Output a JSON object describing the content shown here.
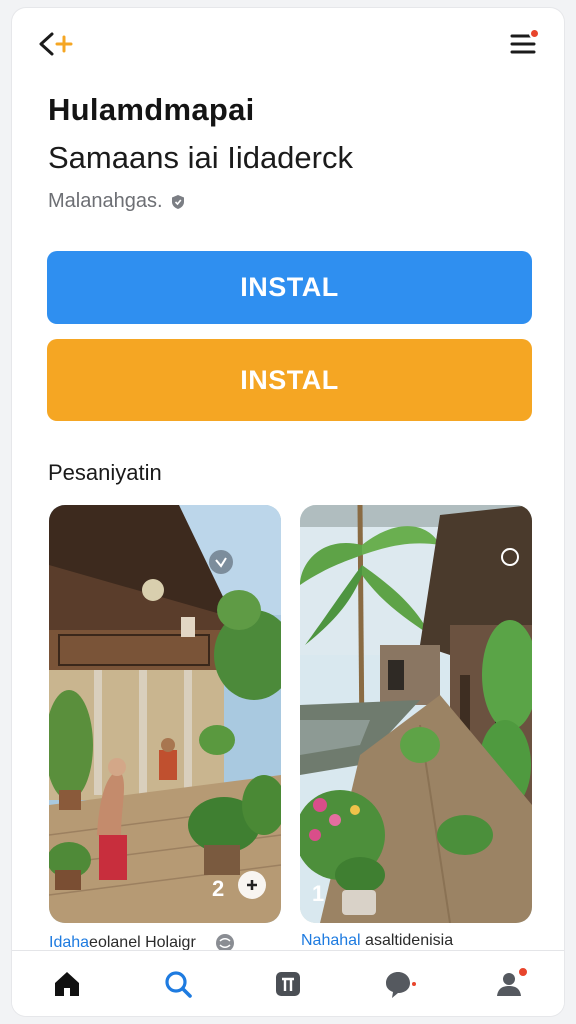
{
  "header": {
    "back_icon": "back-arrow-sparkle-icon",
    "menu_icon": "hamburger-menu-icon",
    "menu_has_notification": true
  },
  "app": {
    "title": "Hulamdmapai",
    "subtitle": "Samaans iai Iidaderck",
    "developer": "Malanahgas."
  },
  "actions": {
    "primary_label": "INSTAL",
    "secondary_label": "INSTAL"
  },
  "screenshots": {
    "section_title": "Pesaniyatin",
    "items": [
      {
        "badge_number": "2",
        "caption_accent": "Idaha",
        "caption_rest": "eolanel Holaigr"
      },
      {
        "badge_number": "1",
        "caption_accent": "Nahahal",
        "caption_rest": " asaltidenisia"
      }
    ]
  },
  "nav": {
    "items": [
      {
        "name": "home",
        "icon": "home-icon",
        "active": false
      },
      {
        "name": "search",
        "icon": "search-icon",
        "active": true
      },
      {
        "name": "apps",
        "icon": "apps-icon",
        "active": false
      },
      {
        "name": "messages",
        "icon": "chat-bubble-icon",
        "active": false
      },
      {
        "name": "profile",
        "icon": "profile-icon",
        "active": false
      }
    ]
  },
  "colors": {
    "primary_button": "#2f8ff0",
    "secondary_button": "#f5a623",
    "accent_text": "#1e7be0",
    "notification": "#e8452c"
  }
}
